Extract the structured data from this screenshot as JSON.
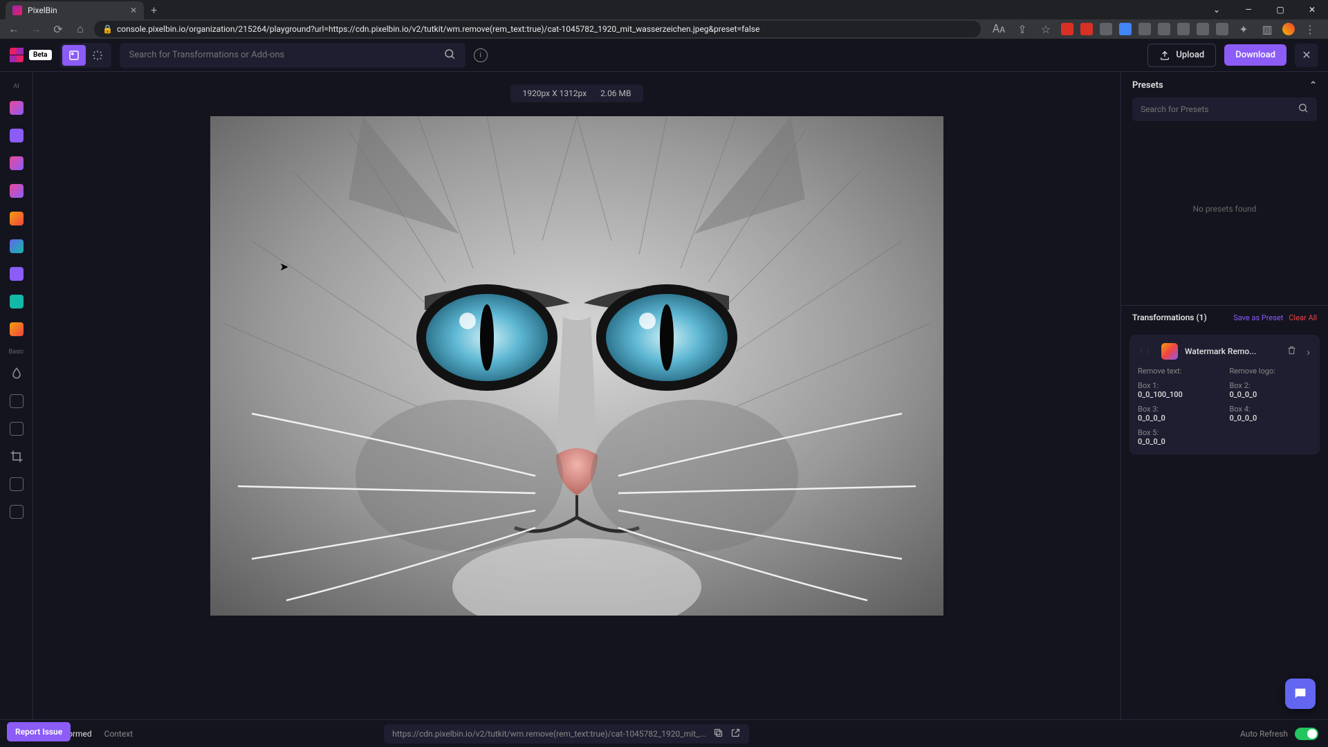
{
  "browser": {
    "tab_title": "PixelBin",
    "url": "console.pixelbin.io/organization/215264/playground?url=https://cdn.pixelbin.io/v2/tutkit/wm.remove(rem_text:true)/cat-1045782_1920_mit_wasserzeichen.jpeg&preset=false"
  },
  "header": {
    "beta_label": "Beta",
    "search_placeholder": "Search for Transformations or Add-ons",
    "upload_label": "Upload",
    "download_label": "Download"
  },
  "left_rail": {
    "section_ai": "AI",
    "section_basic": "Basic"
  },
  "canvas": {
    "dimensions": "1920px X 1312px",
    "filesize": "2.06 MB"
  },
  "presets": {
    "title": "Presets",
    "search_placeholder": "Search for Presets",
    "empty_message": "No presets found"
  },
  "transformations": {
    "title": "Transformations (1)",
    "save_preset": "Save as Preset",
    "clear_all": "Clear All",
    "card": {
      "name": "Watermark Remo...",
      "fields": {
        "remove_text_label": "Remove text:",
        "remove_logo_label": "Remove logo:",
        "box1_label": "Box 1:",
        "box1_value": "0_0_100_100",
        "box2_label": "Box 2:",
        "box2_value": "0_0_0_0",
        "box3_label": "Box 3:",
        "box3_value": "0_0_0_0",
        "box4_label": "Box 4:",
        "box4_value": "0_0_0_0",
        "box5_label": "Box 5:",
        "box5_value": "0_0_0_0"
      }
    }
  },
  "bottom": {
    "tab_transformed": "Transformed",
    "tab_context": "Context",
    "cdn_url": "https://cdn.pixelbin.io/v2/tutkit/wm.remove(rem_text:true)/cat-1045782_1920_mit_...",
    "auto_refresh_label": "Auto Refresh"
  },
  "report_issue": "Report Issue"
}
